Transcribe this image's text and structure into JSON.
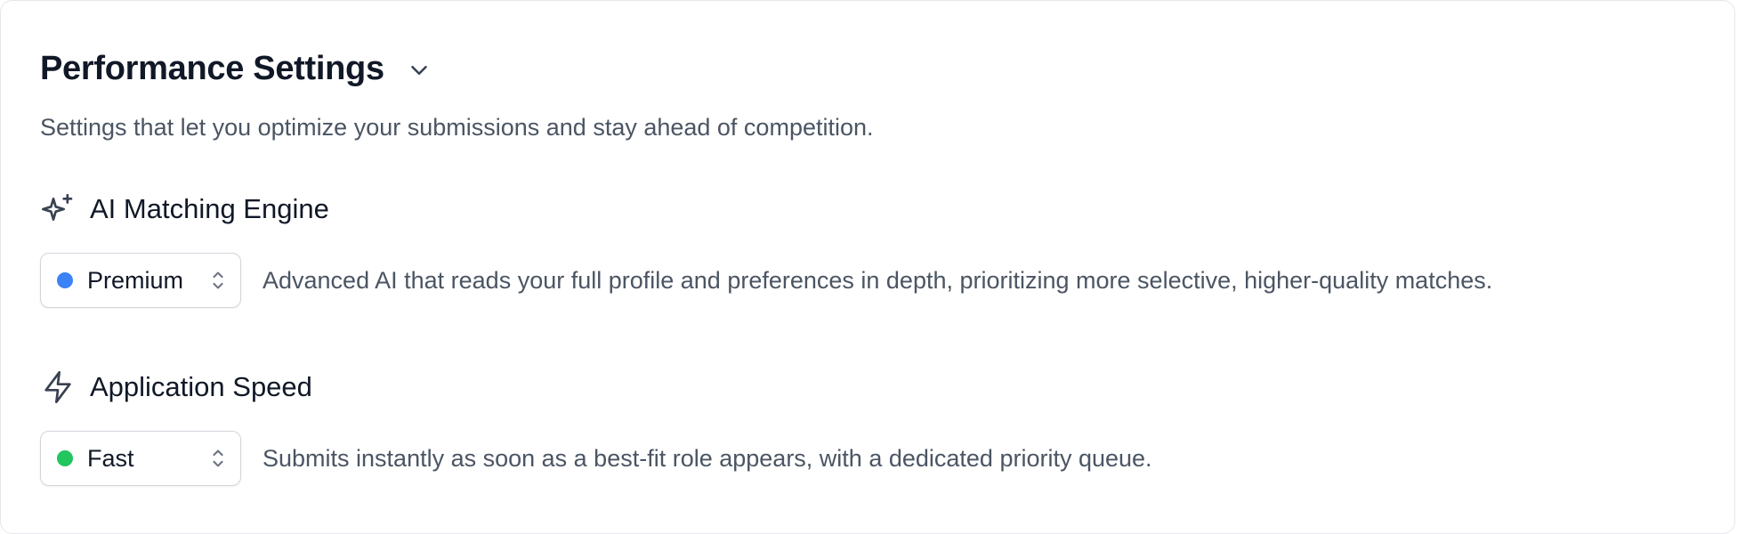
{
  "section": {
    "title": "Performance Settings",
    "subtitle": "Settings that let you optimize your submissions and stay ahead of competition."
  },
  "settings": [
    {
      "name": "AI Matching Engine",
      "icon": "sparkles-icon",
      "selected": "Premium",
      "status_color": "#3b82f6",
      "description": "Advanced AI that reads your full profile and preferences in depth, prioritizing more selective, higher-quality matches."
    },
    {
      "name": "Application Speed",
      "icon": "lightning-bolt-icon",
      "selected": "Fast",
      "status_color": "#22c55e",
      "description": "Submits instantly as soon as a best-fit role appears, with a dedicated priority queue."
    }
  ]
}
